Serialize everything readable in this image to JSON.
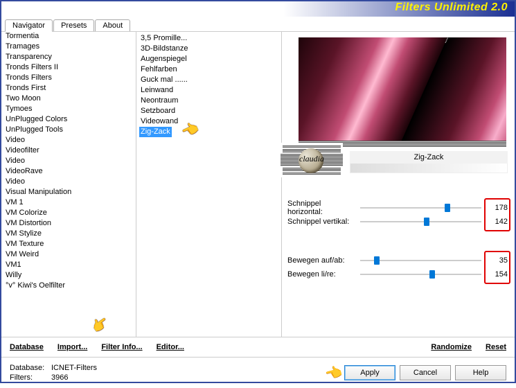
{
  "header": {
    "title": "Filters Unlimited 2.0"
  },
  "tabs": [
    "Navigator",
    "Presets",
    "About"
  ],
  "leftList": [
    "Tormentia",
    "Tramages",
    "Transparency",
    "Tronds Filters II",
    "Tronds Filters",
    "Tronds First",
    "Two Moon",
    "Tymoes",
    "UnPlugged Colors",
    "UnPlugged Tools",
    "Video",
    "Videofilter",
    "Video",
    "VideoRave",
    "Video",
    "Visual Manipulation",
    "VM 1",
    "VM Colorize",
    "VM Distortion",
    "VM Stylize",
    "VM Texture",
    "VM Weird",
    "VM1",
    "Willy",
    "°v° Kiwi's Oelfilter"
  ],
  "leftSelectedIndex": 24,
  "midList": [
    "3,5 Promille...",
    "3D-Bildstanze",
    "Augenspiegel",
    "Fehlfarben",
    "Guck mal ......",
    "Leinwand",
    "Neontraum",
    "Setzboard",
    "Videowand",
    "Zig-Zack"
  ],
  "midSelectedIndex": 9,
  "filterName": "Zig-Zack",
  "badgeText": "claudia",
  "params": [
    {
      "label": "Schnippel horizontal:",
      "value": "178",
      "pos": 0.73
    },
    {
      "label": "Schnippel vertikal:",
      "value": "142",
      "pos": 0.55
    }
  ],
  "params2": [
    {
      "label": "Bewegen auf/ab:",
      "value": "35",
      "pos": 0.12
    },
    {
      "label": "Bewegen li/re:",
      "value": "154",
      "pos": 0.6
    }
  ],
  "links": {
    "database": "Database",
    "import": "Import...",
    "filterInfo": "Filter Info...",
    "editor": "Editor...",
    "randomize": "Randomize",
    "reset": "Reset"
  },
  "footer": {
    "dbLabel": "Database:",
    "dbValue": "ICNET-Filters",
    "filtersLabel": "Filters:",
    "filtersValue": "3966"
  },
  "buttons": {
    "apply": "Apply",
    "cancel": "Cancel",
    "help": "Help"
  }
}
